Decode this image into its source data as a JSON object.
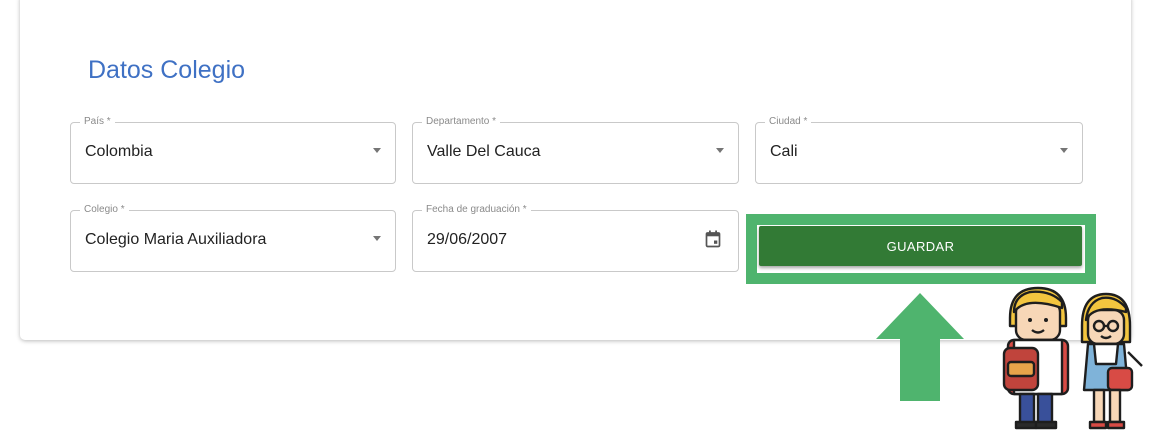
{
  "section": {
    "title": "Datos Colegio"
  },
  "fields": {
    "pais": {
      "label": "País *",
      "value": "Colombia"
    },
    "departamento": {
      "label": "Departamento *",
      "value": "Valle Del Cauca"
    },
    "ciudad": {
      "label": "Ciudad *",
      "value": "Cali"
    },
    "colegio": {
      "label": "Colegio *",
      "value": "Colegio Maria Auxiliadora"
    },
    "fecha": {
      "label": "Fecha de graduación *",
      "value": "29/06/2007"
    }
  },
  "actions": {
    "save_label": "GUARDAR"
  },
  "colors": {
    "title": "#3f71c4",
    "button": "#327a35",
    "highlight": "#4fb46e",
    "arrow": "#4fb46e"
  },
  "icons": [
    "dropdown-caret-icon",
    "calendar-icon",
    "up-arrow-icon",
    "students-illustration"
  ]
}
